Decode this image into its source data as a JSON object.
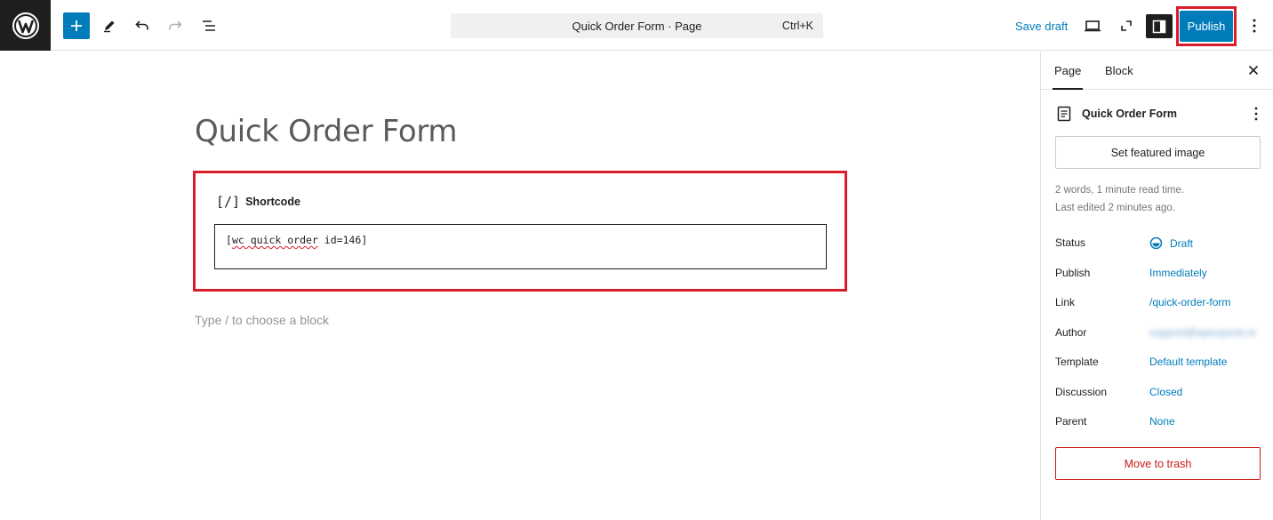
{
  "toolbar": {
    "title": "Quick Order Form · Page",
    "shortcut": "Ctrl+K",
    "save_draft": "Save draft",
    "publish": "Publish"
  },
  "editor": {
    "page_title": "Quick Order Form",
    "block_name": "Shortcode",
    "shortcode_part1": "[",
    "shortcode_squig": "wc quick order",
    "shortcode_part2": " id=146]",
    "placeholder": "Type / to choose a block"
  },
  "sidebar": {
    "tab_page": "Page",
    "tab_block": "Block",
    "doc_title": "Quick Order Form",
    "featured_image": "Set featured image",
    "meta_words": "2 words, 1 minute read time.",
    "meta_edited": "Last edited 2 minutes ago.",
    "rows": [
      {
        "label": "Status",
        "value": "Draft"
      },
      {
        "label": "Publish",
        "value": "Immediately"
      },
      {
        "label": "Link",
        "value": "/quick-order-form"
      },
      {
        "label": "Author",
        "value": "support@wpexperts.io"
      },
      {
        "label": "Template",
        "value": "Default template"
      },
      {
        "label": "Discussion",
        "value": "Closed"
      },
      {
        "label": "Parent",
        "value": "None"
      }
    ],
    "trash": "Move to trash"
  },
  "colors": {
    "accent": "#007cba",
    "highlight": "#d81e2c",
    "destructive": "#cc1818",
    "dark": "#1e1e1e"
  },
  "icons": [
    "wordpress-logo-icon",
    "plus-icon",
    "pencil-icon",
    "undo-icon",
    "redo-icon",
    "list-view-icon",
    "desktop-preview-icon",
    "fullscreen-icon",
    "settings-sidebar-icon",
    "more-vertical-icon",
    "close-icon",
    "page-icon",
    "shortcode-icon",
    "draft-status-icon"
  ]
}
